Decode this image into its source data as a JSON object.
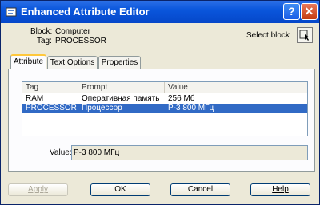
{
  "window": {
    "title": "Enhanced Attribute Editor",
    "help_glyph": "?",
    "close_glyph": "✕"
  },
  "header": {
    "block_label": "Block:",
    "block_value": "Computer",
    "tag_label": "Tag:",
    "tag_value": "PROCESSOR",
    "select_block_label": "Select block"
  },
  "tabs": [
    {
      "label": "Attribute",
      "active": true
    },
    {
      "label": "Text Options",
      "active": false
    },
    {
      "label": "Properties",
      "active": false
    }
  ],
  "table": {
    "columns": [
      "Tag",
      "Prompt",
      "Value"
    ],
    "rows": [
      {
        "tag": "RAM",
        "prompt": "Оперативная память",
        "value": "256 Мб",
        "selected": false
      },
      {
        "tag": "PROCESSOR",
        "prompt": "Процессор",
        "value": "Р-3 800 МГц",
        "selected": true
      }
    ]
  },
  "value_field": {
    "label": "Value:",
    "value": "Р-3 800 МГц"
  },
  "buttons": {
    "apply": "Apply",
    "ok": "OK",
    "cancel": "Cancel",
    "help": "Help"
  }
}
